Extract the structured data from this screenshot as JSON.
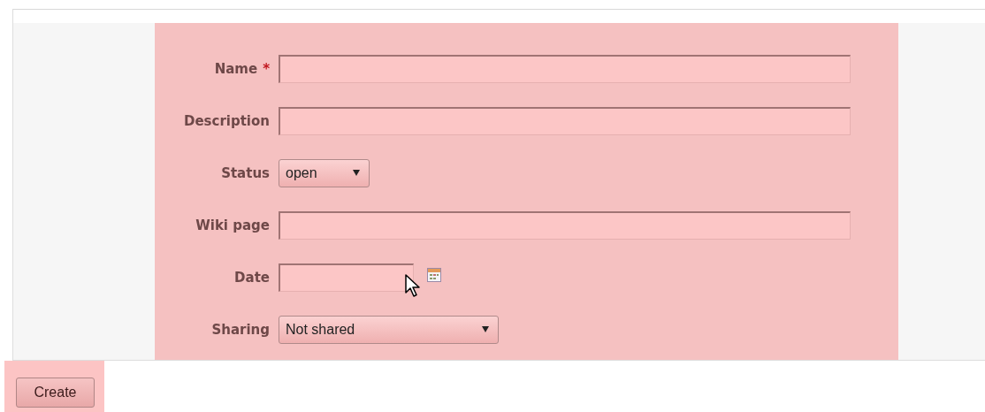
{
  "fields": [
    {
      "kind": "text",
      "label": "Name",
      "required_mark": "*"
    },
    {
      "kind": "text",
      "label": "Description"
    },
    {
      "kind": "select",
      "label": "Status",
      "value": "open"
    },
    {
      "kind": "text",
      "label": "Wiki page"
    },
    {
      "kind": "date",
      "label": "Date"
    },
    {
      "kind": "select",
      "label": "Sharing",
      "value": "Not shared"
    }
  ],
  "buttons": [
    "Create"
  ]
}
